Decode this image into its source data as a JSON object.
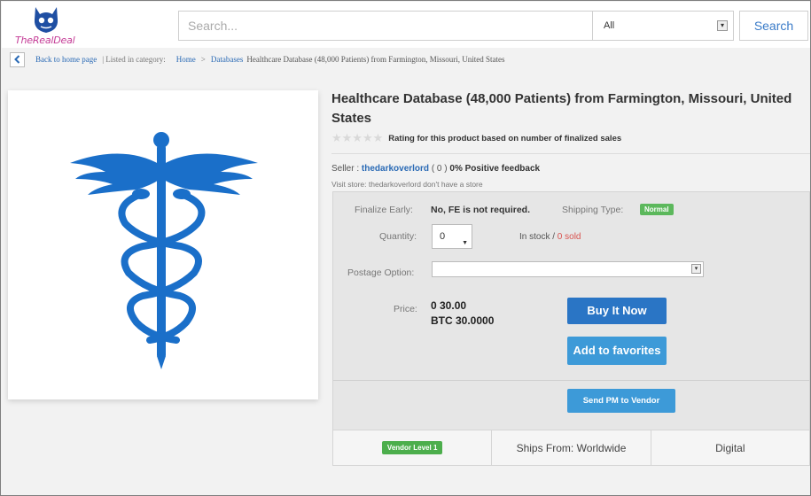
{
  "header": {
    "logo_text": "TheRealDeal",
    "search_placeholder": "Search...",
    "category_select": "All",
    "search_button": "Search",
    "colors": {
      "logo": "#1f4fa3",
      "logo_text": "#c43b96",
      "link": "#2a6ab5"
    }
  },
  "breadcrumb": {
    "back": "Back to home page",
    "listed": "| Listed in category:",
    "home": "Home",
    "sep": ">",
    "databases": "Databases",
    "current": "Healthcare Database (48,000 Patients) from Farmington, Missouri, United States"
  },
  "product": {
    "title": "Healthcare Database (48,000 Patients) from Farmington, Missouri, United States",
    "image_icon": "caduceus-icon",
    "stars": "★★★★★",
    "rating_text": "Rating for this product based on number of finalized sales",
    "seller_prefix": "Seller :",
    "seller_name": "thedarkoverlord",
    "seller_count": "( 0 )",
    "seller_feedback": "0% Positive feedback",
    "visit_store": "Visit store:  thedarkoverlord don't have a store"
  },
  "purchase": {
    "finalize_label": "Finalize Early:",
    "finalize_value": "No, FE is not required.",
    "shipping_label": "Shipping Type:",
    "shipping_badge": "Normal",
    "quantity_label": "Quantity:",
    "quantity_value": "0",
    "stock_text": "In stock /",
    "stock_sold": "0 sold",
    "postage_label": "Postage Option:",
    "postage_value": "",
    "price_label": "Price:",
    "price_value": "0 30.00",
    "price_btc": "BTC 30.0000",
    "buy_button": "Buy It Now",
    "fav_button": "Add to favorites",
    "pm_button": "Send PM to Vendor"
  },
  "footer": {
    "vendor_level": "Vendor Level 1",
    "ships_from": "Ships From: Worldwide",
    "type": "Digital"
  }
}
